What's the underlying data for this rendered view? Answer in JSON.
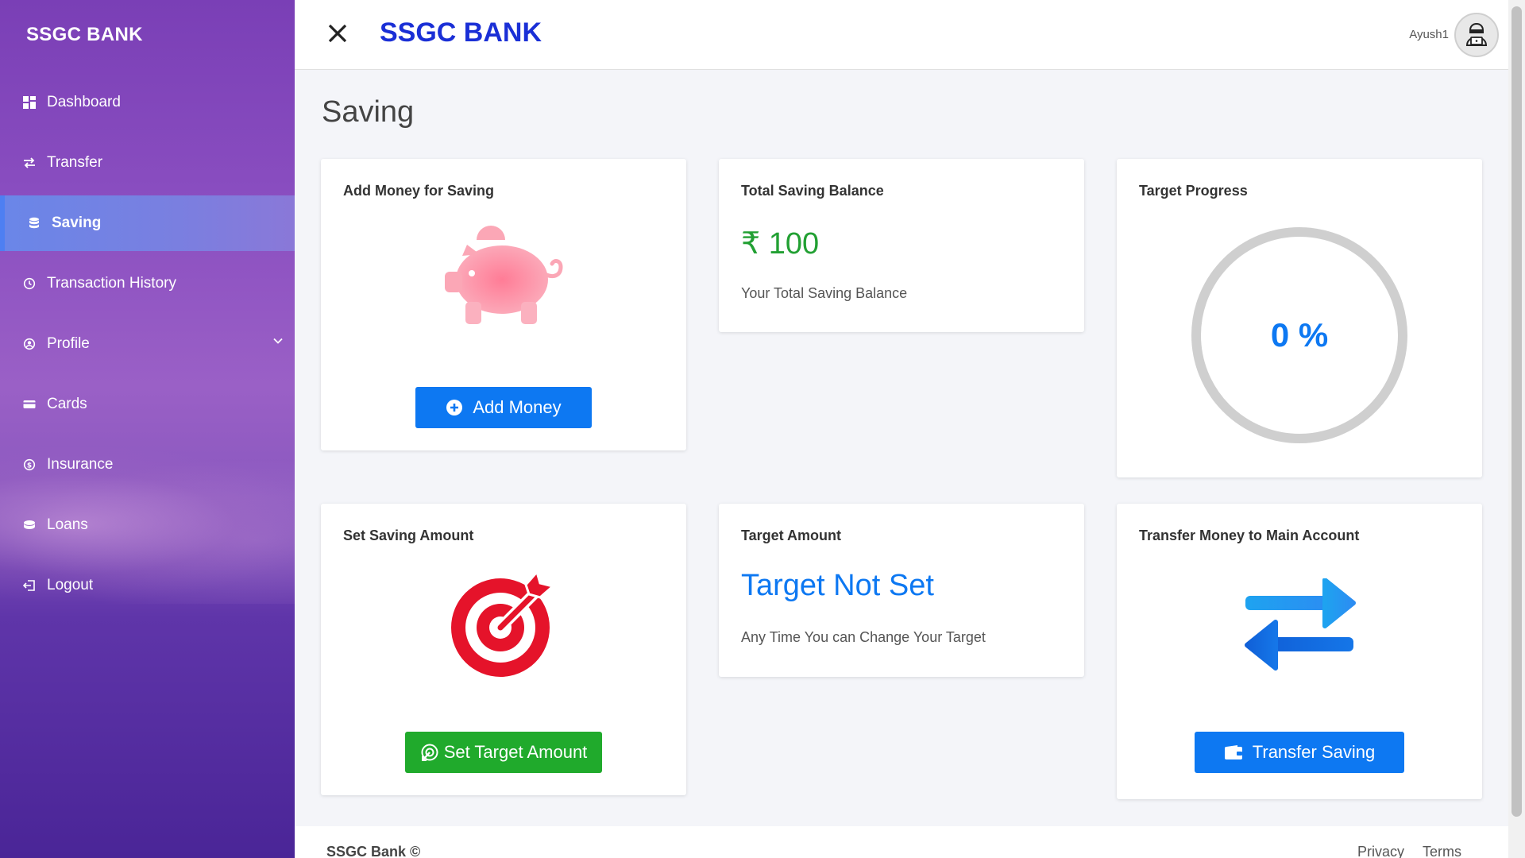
{
  "sidebar": {
    "title": "SSGC BANK",
    "items": [
      {
        "label": "Dashboard"
      },
      {
        "label": "Transfer"
      },
      {
        "label": "Saving"
      },
      {
        "label": "Transaction History"
      },
      {
        "label": "Profile"
      },
      {
        "label": "Cards"
      },
      {
        "label": "Insurance"
      },
      {
        "label": "Loans"
      },
      {
        "label": "Logout"
      }
    ]
  },
  "header": {
    "title": "SSGC BANK",
    "username": "Ayush1"
  },
  "main": {
    "page_title": "Saving",
    "add_money_card": {
      "title": "Add Money for Saving",
      "button": "Add Money"
    },
    "balance_card": {
      "title": "Total Saving Balance",
      "value": "₹ 100",
      "caption": "Your Total Saving Balance"
    },
    "progress_card": {
      "title": "Target Progress",
      "value": "0 %",
      "progress_fraction": 0
    },
    "set_saving_card": {
      "title": "Set Saving Amount",
      "button": "Set Target Amount"
    },
    "target_card": {
      "title": "Target Amount",
      "value": "Target Not Set",
      "caption": "Any Time You can Change Your Target"
    },
    "transfer_card": {
      "title": "Transfer Money to Main Account",
      "button": "Transfer Saving"
    }
  },
  "footer": {
    "copyright": "SSGC Bank ©",
    "privacy": "Privacy",
    "terms": "Terms"
  },
  "colors": {
    "accent": "#0d78f2",
    "brand_title": "#1a2fd6",
    "success": "#20aa2c",
    "balance_green": "#22a033"
  }
}
